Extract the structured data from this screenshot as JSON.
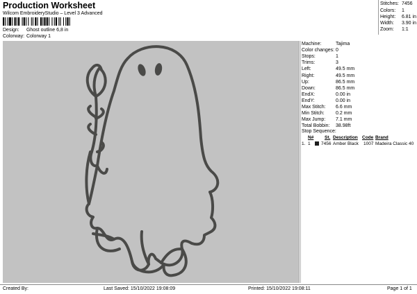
{
  "header": {
    "title": "Production Worksheet",
    "subtitle": "Wilcom EmbroideryStudio – Level 3 Advanced",
    "barcode_text": ", "
  },
  "design_info": {
    "design_label": "Design:",
    "design_value": "Ghost outline 6,8 in",
    "colorway_label": "Colorway:",
    "colorway_value": "Colorway 1"
  },
  "summary": {
    "stitches_label": "Stitches:",
    "stitches_value": "7456",
    "colors_label": "Colors:",
    "colors_value": "1",
    "height_label": "Height:",
    "height_value": "6.81 in",
    "width_label": "Width:",
    "width_value": "3.90 in",
    "zoom_label": "Zoom:",
    "zoom_value": "1:1"
  },
  "stats": [
    {
      "label": "Machine:",
      "value": "Tajima"
    },
    {
      "label": "Color changes:",
      "value": "0"
    },
    {
      "label": "Stops:",
      "value": "1"
    },
    {
      "label": "Trims:",
      "value": "3"
    },
    {
      "label": "Left:",
      "value": "49.5 mm"
    },
    {
      "label": "Right:",
      "value": "49.5 mm"
    },
    {
      "label": "Up:",
      "value": "86.5 mm"
    },
    {
      "label": "Down:",
      "value": "86.5 mm"
    },
    {
      "label": "EndX:",
      "value": "0.00 in"
    },
    {
      "label": "EndY:",
      "value": "0.00 in"
    },
    {
      "label": "Max Stitch:",
      "value": "6.6 mm"
    },
    {
      "label": "Min Stitch:",
      "value": "0.2 mm"
    },
    {
      "label": "Max Jump:",
      "value": "7.1 mm"
    },
    {
      "label": "Total Bobbin:",
      "value": "38.98ft"
    }
  ],
  "stop_sequence": {
    "heading": "Stop Sequence:",
    "columns": [
      "N#",
      "St.",
      "Description",
      "Code",
      "Brand"
    ],
    "rows": [
      {
        "index": "1.",
        "n": "1",
        "st": "7456",
        "description": "Amber Black",
        "code": "1007",
        "brand": "Madeira Classic 40",
        "color": "#1e1e1e"
      }
    ]
  },
  "design_colors": {
    "background": "#c2c2c2",
    "thread": "#4a4a48",
    "thread_highlight": "#7d7d79"
  },
  "footer": {
    "created_by": "Created By:",
    "last_saved": "Last Saved: 15/10/2022 19:08:09",
    "printed": "Printed: 15/10/2022 19:08:11",
    "page": "Page 1 of 1"
  }
}
